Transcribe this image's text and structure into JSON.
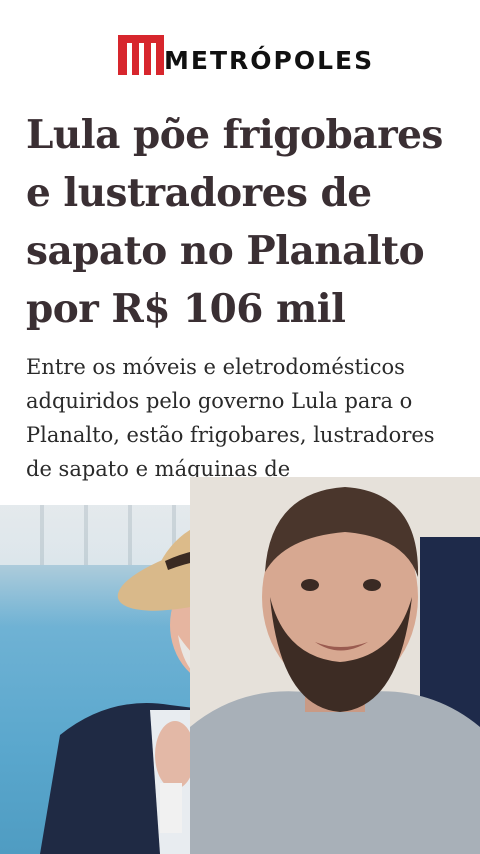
{
  "header": {
    "brand": "METRÓPOLES",
    "brand_color": "#d7262d"
  },
  "article": {
    "headline": "Lula põe frigobares e lustradores de sapato no Planalto por R$ 106 mil",
    "lede": "Entre os móveis e eletrodomésticos adquiridos pelo governo Lula para o Planalto, estão frigobares, lustradores de sapato e máquinas de"
  },
  "images": {
    "article_photo": "photo of Lula in a straw hat",
    "webcam_overlay": "bearded man speaking to camera"
  }
}
